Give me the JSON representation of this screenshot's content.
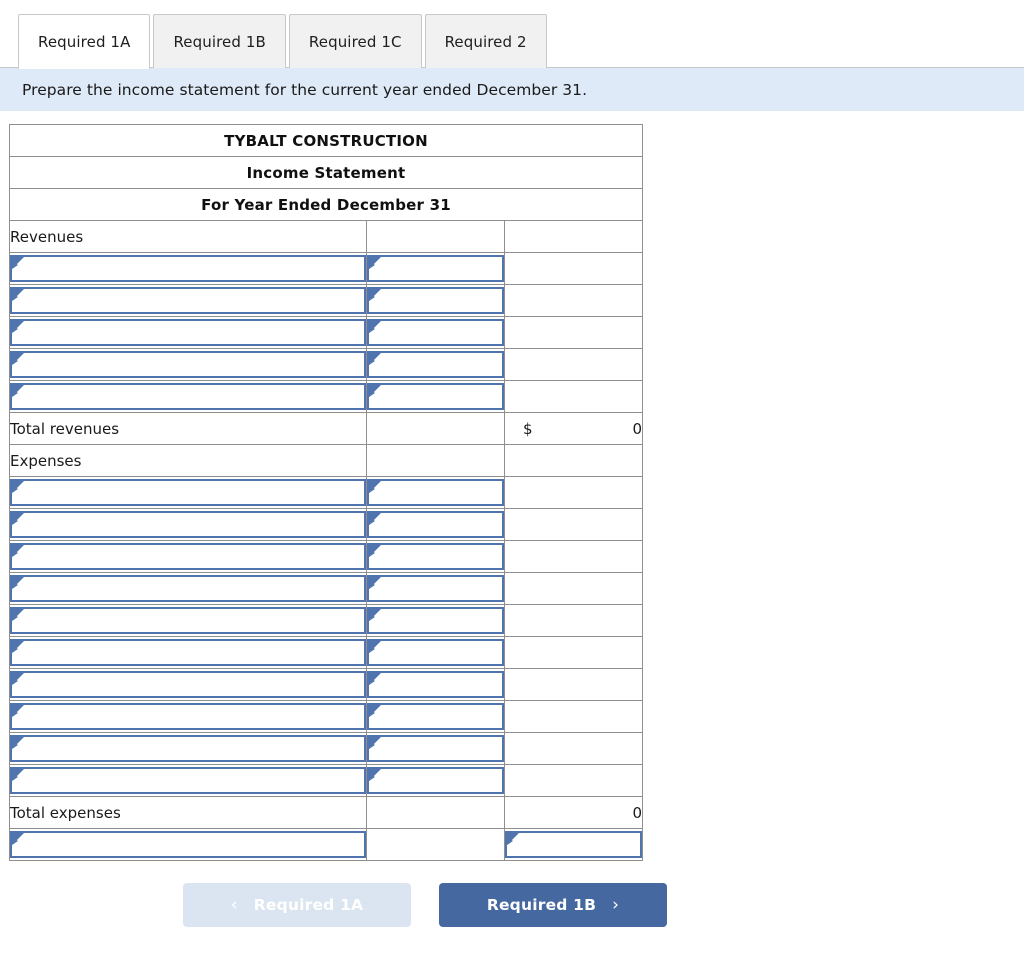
{
  "tabs": [
    {
      "label": "Required 1A",
      "active": true
    },
    {
      "label": "Required 1B",
      "active": false
    },
    {
      "label": "Required 1C",
      "active": false
    },
    {
      "label": "Required 2",
      "active": false
    }
  ],
  "instruction": {
    "text": "Prepare the income statement for the current year ended December 31."
  },
  "statement": {
    "company": "TYBALT CONSTRUCTION",
    "report": "Income Statement",
    "period": "For Year Ended December 31",
    "revenues_label": "Revenues",
    "expenses_label": "Expenses",
    "total_revenues_label": "Total revenues",
    "total_revenues_currency": "$",
    "total_revenues_value": "0",
    "total_expenses_label": "Total expenses",
    "total_expenses_value": "0",
    "revenue_rows": [
      {
        "desc": "",
        "amount": ""
      },
      {
        "desc": "",
        "amount": ""
      },
      {
        "desc": "",
        "amount": ""
      },
      {
        "desc": "",
        "amount": ""
      },
      {
        "desc": "",
        "amount": ""
      }
    ],
    "expense_rows": [
      {
        "desc": "",
        "amount": ""
      },
      {
        "desc": "",
        "amount": ""
      },
      {
        "desc": "",
        "amount": ""
      },
      {
        "desc": "",
        "amount": ""
      },
      {
        "desc": "",
        "amount": ""
      },
      {
        "desc": "",
        "amount": ""
      },
      {
        "desc": "",
        "amount": ""
      },
      {
        "desc": "",
        "amount": ""
      },
      {
        "desc": "",
        "amount": ""
      },
      {
        "desc": "",
        "amount": ""
      }
    ],
    "net_row": {
      "desc": "",
      "total": ""
    }
  },
  "nav": {
    "prev_label": "Required 1A",
    "prev_chevron": "‹",
    "next_label": "Required 1B",
    "next_chevron": "›"
  },
  "colors": {
    "header_blue": "#8aabdf",
    "banner_blue": "#deeaf7",
    "field_border": "#5074ad",
    "next_button": "#44689f",
    "prev_button": "#dbe5f1"
  }
}
